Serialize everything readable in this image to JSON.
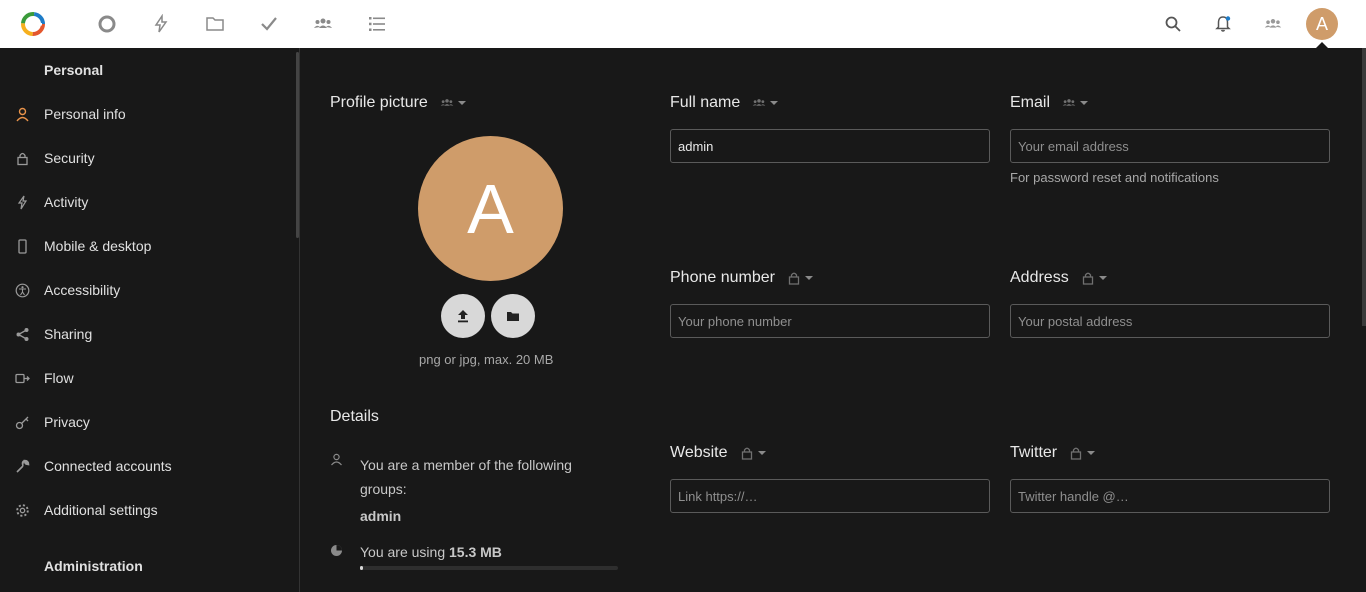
{
  "colors": {
    "accent": "#cf9c6a",
    "background": "#181818",
    "topbar": "#ffffff"
  },
  "topbar": {
    "app_icons": [
      "dashboard-icon",
      "activity-icon",
      "files-icon",
      "tasks-icon",
      "contacts-icon",
      "deck-icon"
    ],
    "right_icons": [
      "search-icon",
      "notifications-icon",
      "contacts-menu-icon"
    ],
    "avatar_letter": "A"
  },
  "sidebar": {
    "heading": "Personal",
    "items": [
      {
        "label": "Personal info",
        "icon": "user-icon",
        "active": true
      },
      {
        "label": "Security",
        "icon": "lock-icon"
      },
      {
        "label": "Activity",
        "icon": "lightning-icon"
      },
      {
        "label": "Mobile & desktop",
        "icon": "phone-icon"
      },
      {
        "label": "Accessibility",
        "icon": "accessibility-icon"
      },
      {
        "label": "Sharing",
        "icon": "share-icon"
      },
      {
        "label": "Flow",
        "icon": "flow-icon"
      },
      {
        "label": "Privacy",
        "icon": "key-icon"
      },
      {
        "label": "Connected accounts",
        "icon": "wrench-icon"
      },
      {
        "label": "Additional settings",
        "icon": "gear-icon"
      }
    ],
    "heading2": "Administration"
  },
  "profile": {
    "picture_title": "Profile picture",
    "avatar_letter": "A",
    "picture_hint": "png or jpg, max. 20 MB",
    "details_title": "Details",
    "groups_text": "You are a member of the following groups:",
    "group_name": "admin",
    "usage_prefix": "You are using ",
    "usage_value": "15.3 MB",
    "usage_fraction": 0.01
  },
  "fields": {
    "fullname": {
      "label": "Full name",
      "value": "admin"
    },
    "email": {
      "label": "Email",
      "placeholder": "Your email address",
      "hint": "For password reset and notifications"
    },
    "phone": {
      "label": "Phone number",
      "placeholder": "Your phone number"
    },
    "address": {
      "label": "Address",
      "placeholder": "Your postal address"
    },
    "website": {
      "label": "Website",
      "placeholder": "Link https://…"
    },
    "twitter": {
      "label": "Twitter",
      "placeholder": "Twitter handle @…"
    }
  }
}
